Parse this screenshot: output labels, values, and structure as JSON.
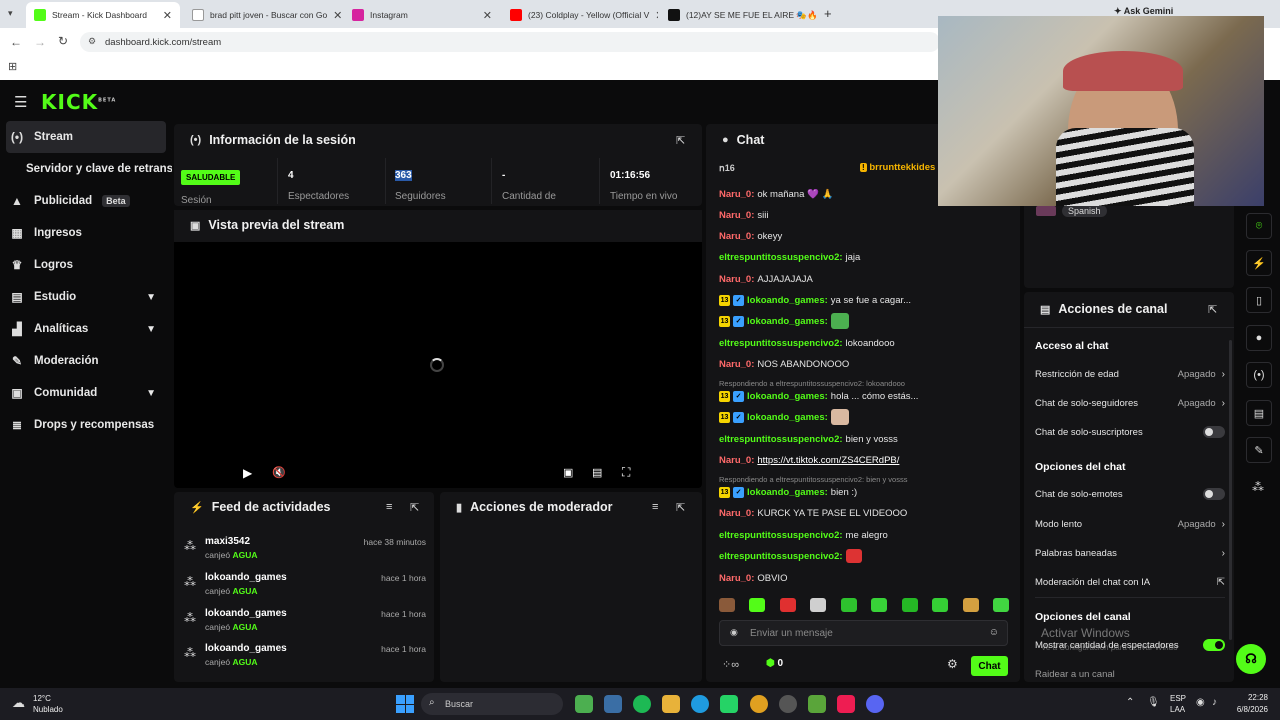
{
  "browser": {
    "tabs": [
      {
        "label": "Stream - Kick Dashboard",
        "active": true
      },
      {
        "label": "brad pitt joven - Buscar con Go"
      },
      {
        "label": "Instagram"
      },
      {
        "label": "(23) Coldplay - Yellow (Official V"
      },
      {
        "label": "(12)AY SE ME FUE EL AIRE 🎭🔥"
      }
    ],
    "url": "dashboard.kick.com/stream",
    "ask_gemini": "Ask Gemini"
  },
  "sidebar": {
    "logo": "KICK",
    "logo_sup": "BETA",
    "items": [
      {
        "label": "Stream",
        "icon": "broadcast-icon"
      },
      {
        "label": "Servidor y clave de retransm"
      },
      {
        "label": "Publicidad",
        "badge": "Beta",
        "icon": "megaphone-icon"
      },
      {
        "label": "Ingresos",
        "icon": "chart-icon"
      },
      {
        "label": "Logros",
        "icon": "trophy-icon"
      },
      {
        "label": "Estudio",
        "icon": "studio-icon"
      },
      {
        "label": "Analíticas",
        "icon": "analytics-icon"
      },
      {
        "label": "Moderación",
        "icon": "wrench-icon"
      },
      {
        "label": "Comunidad",
        "icon": "community-icon"
      },
      {
        "label": "Drops y recompensas",
        "icon": "list-icon"
      }
    ]
  },
  "session": {
    "title": "Información de la sesión",
    "status_badge": "SALUDABLE",
    "status_label": "Sesión",
    "viewers_value": "4",
    "viewers_label": "Espectadores",
    "followers_value": "363",
    "followers_label": "Seguidores",
    "amount_value": "-",
    "amount_label": "Cantidad de",
    "time_value": "01:16:56",
    "time_label": "Tiempo en vivo"
  },
  "preview": {
    "title": "Vista previa del stream"
  },
  "feed": {
    "title": "Feed de actividades",
    "items": [
      {
        "name": "maxi3542",
        "action": "canjeó",
        "reward": "AGUA",
        "time": "hace 38 minutos"
      },
      {
        "name": "lokoando_games",
        "action": "canjeó",
        "reward": "AGUA",
        "time": "hace 1 hora"
      },
      {
        "name": "lokoando_games",
        "action": "canjeó",
        "reward": "AGUA",
        "time": "hace 1 hora"
      },
      {
        "name": "lokoando_games",
        "action": "canjeó",
        "reward": "AGUA",
        "time": "hace 1 hora"
      }
    ]
  },
  "modactions": {
    "title": "Acciones de moderador"
  },
  "chat": {
    "title": "Chat",
    "pinned_left": "ո16",
    "pinned_right": "brrunttekkides",
    "m1": {
      "user": "Naru_0:",
      "text": "ok mañana 💜 🙏"
    },
    "m2": {
      "user": "Naru_0:",
      "text": "siii"
    },
    "m3": {
      "user": "Naru_0:",
      "text": "okeyy"
    },
    "m4": {
      "user": "eltrespuntitossuspencivo2:",
      "text": "jaja"
    },
    "m5": {
      "user": "Naru_0:",
      "text": "AJJAJAJAJA"
    },
    "m6": {
      "badge": "13",
      "user": "lokoando_games:",
      "text": "ya se fue a cagar..."
    },
    "m7": {
      "badge": "13",
      "user": "lokoando_games:",
      "text": ""
    },
    "m8": {
      "user": "eltrespuntitossuspencivo2:",
      "text": "lokoandooo"
    },
    "m9": {
      "user": "Naru_0:",
      "text": "NOS ABANDONOOO"
    },
    "r1": "Respondiendo a eltrespuntitossuspencivo2: lokoandooo",
    "m10": {
      "badge": "13",
      "user": "lokoando_games:",
      "text": "hola ... cómo estás..."
    },
    "m11": {
      "badge": "13",
      "user": "lokoando_games:",
      "text": ""
    },
    "m12": {
      "user": "eltrespuntitossuspencivo2:",
      "text": "bien y vosss"
    },
    "m13": {
      "user": "Naru_0:",
      "text": "https://vt.tiktok.com/ZS4CERdPB/"
    },
    "r2": "Respondiendo a eltrespuntitossuspencivo2: bien y vosss",
    "m14": {
      "badge": "13",
      "user": "lokoando_games:",
      "text": "bien :)"
    },
    "m15": {
      "user": "Naru_0:",
      "text": "KURCK YA TE PASE EL VIDEOOO"
    },
    "m16": {
      "user": "eltrespuntitossuspencivo2:",
      "text": "me alegro"
    },
    "m17": {
      "user": "eltrespuntitossuspencivo2:",
      "text": ""
    },
    "m18": {
      "user": "Naru_0:",
      "text": "OBVIO"
    },
    "input_placeholder": "Enviar un mensaje",
    "points": "0",
    "send_label": "Chat"
  },
  "language": "Spanish",
  "channel_actions": {
    "title": "Acciones de canal",
    "chat_access": "Acceso al chat",
    "age_label": "Restricción de edad",
    "age_value": "Apagado",
    "followers_label": "Chat de solo-seguidores",
    "followers_value": "Apagado",
    "subs_label": "Chat de solo-suscriptores",
    "chat_options": "Opciones del chat",
    "emotes_label": "Chat de solo-emotes",
    "slow_label": "Modo lento",
    "slow_value": "Apagado",
    "banned_label": "Palabras baneadas",
    "ai_label": "Moderación del chat con IA",
    "channel_options": "Opciones del canal",
    "viewers_count_label": "Mostrar cantidad de espectadores",
    "raid_label": "Raidear a un canal"
  },
  "watermark": {
    "line1": "Activar Windows",
    "line2": "Ve a Configuración para activar Windo"
  },
  "taskbar": {
    "weather_temp": "12°C",
    "weather_text": "Nublado",
    "search": "Buscar",
    "lang1": "ESP",
    "lang2": "LAA",
    "time": "22:28",
    "date": "6/8/2026"
  }
}
